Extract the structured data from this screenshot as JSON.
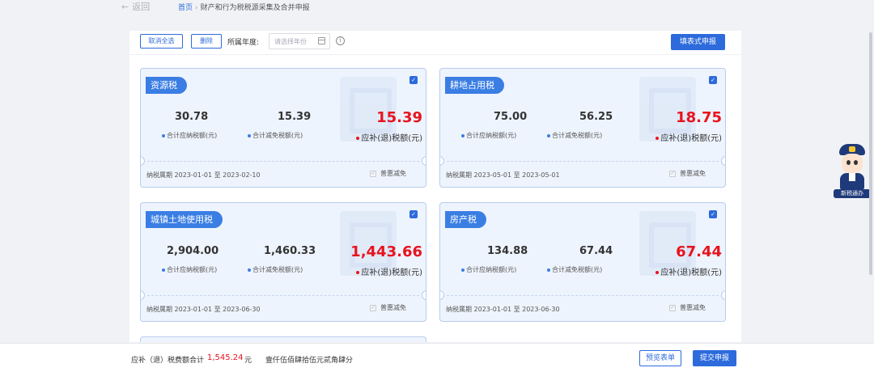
{
  "nav": {
    "back_label": "返回",
    "crumb_home": "首页",
    "crumb_sep": "›",
    "crumb_current": "财产和行为税税源采集及合并申报"
  },
  "toolbar": {
    "deselect_all": "取消全选",
    "delete": "删除",
    "year_label": "所属年度:",
    "year_placeholder": "请选择年份",
    "fill_form": "填表式申报"
  },
  "cards": [
    {
      "title": "资源税",
      "total_payable": "30.78",
      "total_payable_label": "合计应纳税额(元)",
      "total_relief": "15.39",
      "total_relief_label": "合计减免税额(元)",
      "refund": "15.39",
      "refund_label": "应补(退)税额(元)",
      "period": "纳税属期 2023-01-01 至 2023-02-10",
      "preference": "普惠减免",
      "checked": true
    },
    {
      "title": "耕地占用税",
      "total_payable": "75.00",
      "total_payable_label": "合计应纳税额(元)",
      "total_relief": "56.25",
      "total_relief_label": "合计减免税额(元)",
      "refund": "18.75",
      "refund_label": "应补(退)税额(元)",
      "period": "纳税属期 2023-05-01 至 2023-05-01",
      "preference": "普惠减免",
      "checked": true
    },
    {
      "title": "城镇土地使用税",
      "total_payable": "2,904.00",
      "total_payable_label": "合计应纳税额(元)",
      "total_relief": "1,460.33",
      "total_relief_label": "合计减免税额(元)",
      "refund": "1,443.66",
      "refund_label": "应补(退)税额(元)",
      "period": "纳税属期 2023-01-01 至 2023-06-30",
      "preference": "普惠减免",
      "checked": true
    },
    {
      "title": "房产税",
      "total_payable": "134.88",
      "total_payable_label": "合计应纳税额(元)",
      "total_relief": "67.44",
      "total_relief_label": "合计减免税额(元)",
      "refund": "67.44",
      "refund_label": "应补(退)税额(元)",
      "period": "纳税属期 2023-01-01 至 2023-06-30",
      "preference": "普惠减免",
      "checked": true
    }
  ],
  "footer": {
    "sum_label": "应补（退）税费额合计",
    "sum_value": "1,545.24",
    "sum_unit": "元",
    "sum_words": "壹仟伍佰肆拾伍元贰角肆分",
    "preview": "预览表单",
    "submit": "提交申报"
  },
  "assistant": {
    "tag": "新税通办"
  },
  "colors": {
    "primary": "#2d6bdc",
    "accent_red": "#e8131e",
    "card_bg": "#eef4fd"
  }
}
